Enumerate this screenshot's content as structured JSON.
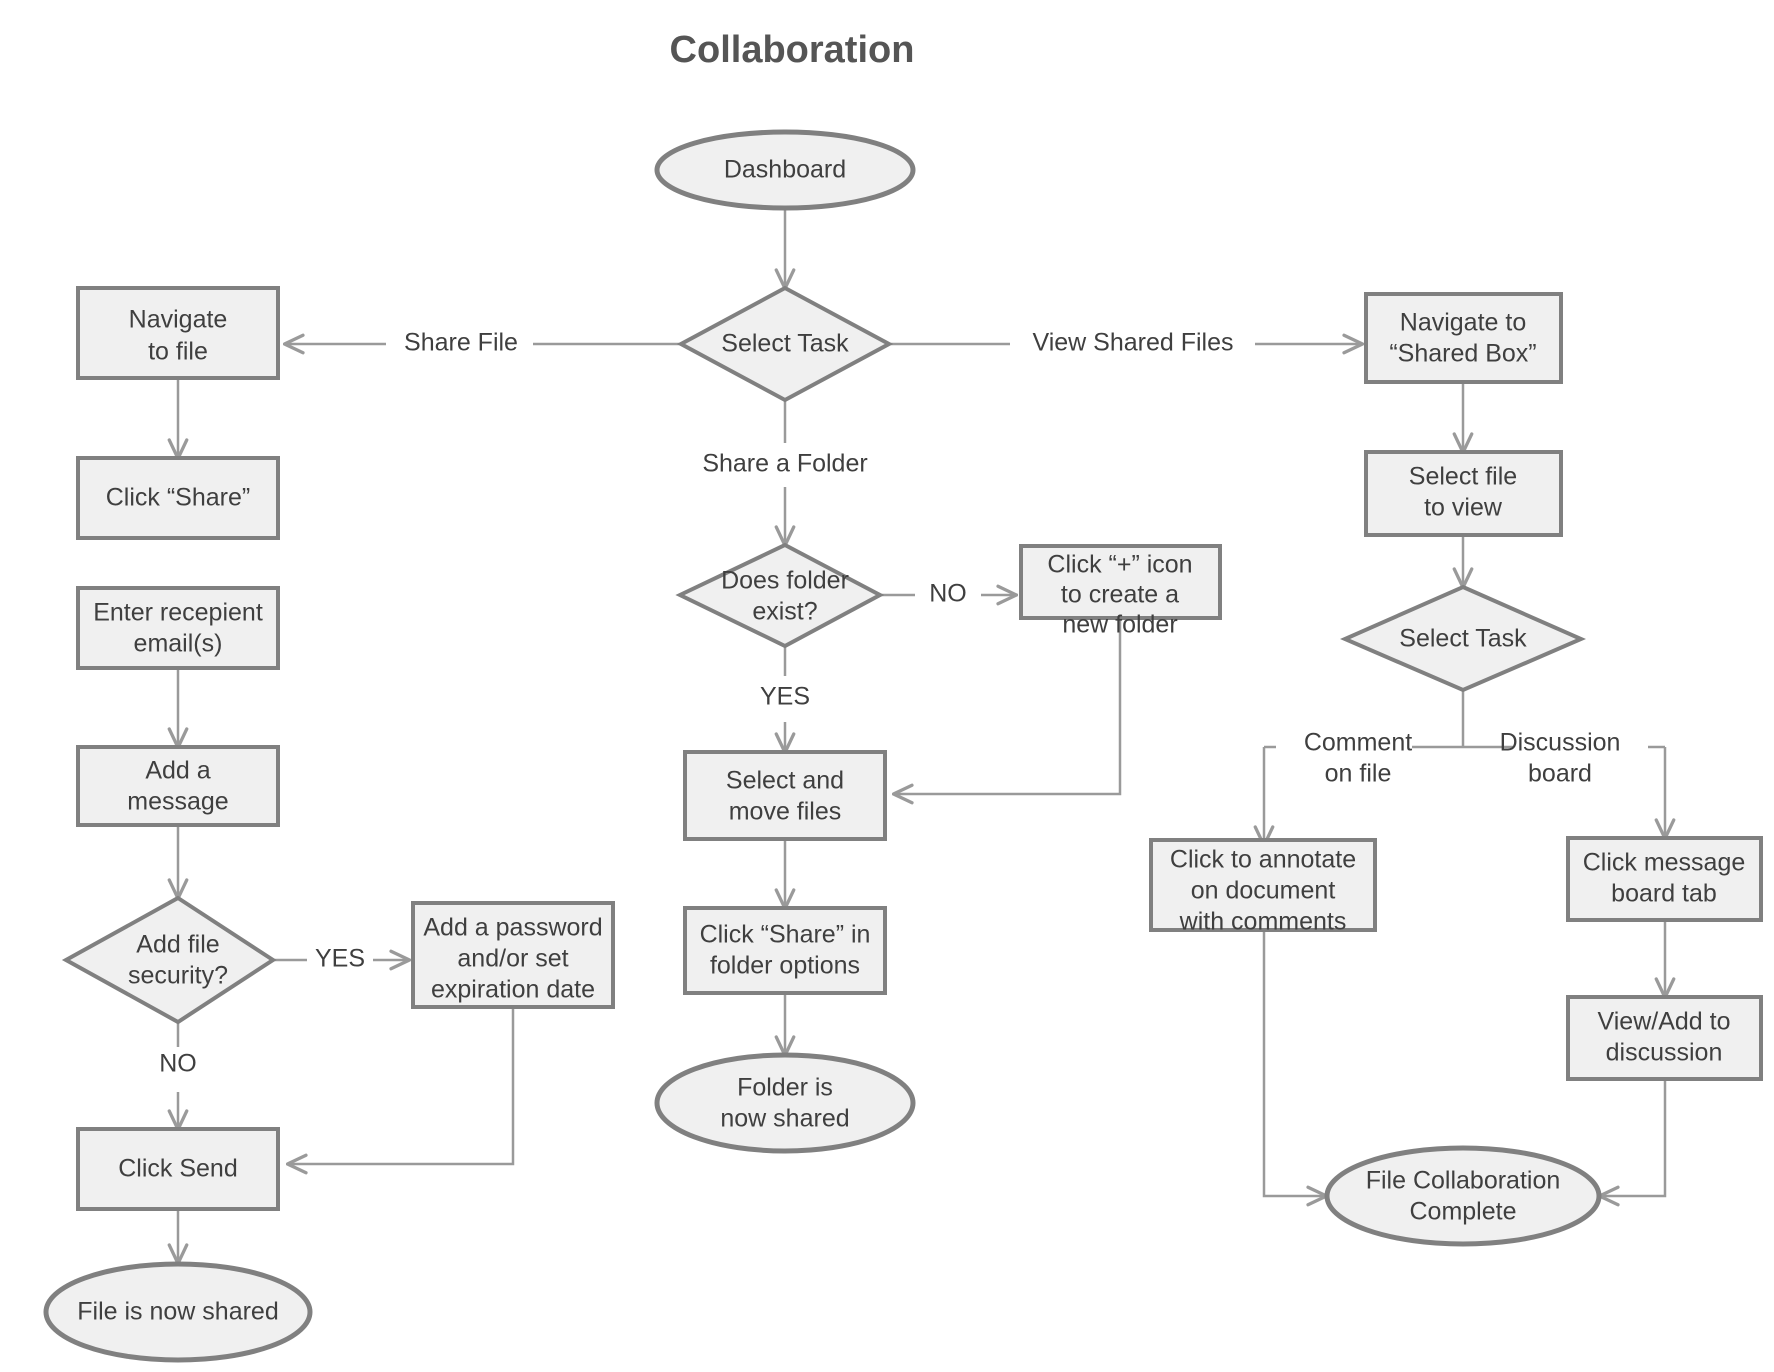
{
  "title": "Collaboration",
  "theme": {
    "node_fill": "#f0f0f0",
    "node_stroke": "#808080",
    "edge_stroke": "#9a9a9a",
    "text_color": "#3f3f3f",
    "title_color": "#555555",
    "background": "#ffffff"
  },
  "chart_data": {
    "type": "diagram",
    "diagram_type": "flowchart",
    "title": "Collaboration",
    "nodes": [
      {
        "id": "dashboard",
        "shape": "ellipse",
        "lines": [
          "Dashboard"
        ]
      },
      {
        "id": "select-task-1",
        "shape": "diamond",
        "lines": [
          "Select Task"
        ]
      },
      {
        "id": "navigate-to-file",
        "shape": "rect",
        "lines": [
          "Navigate",
          "to file"
        ]
      },
      {
        "id": "click-share",
        "shape": "rect",
        "lines": [
          "Click “Share”"
        ]
      },
      {
        "id": "enter-recipient-email",
        "shape": "rect",
        "lines": [
          "Enter recepient",
          "email(s)"
        ]
      },
      {
        "id": "add-a-message",
        "shape": "rect",
        "lines": [
          "Add a",
          "message"
        ]
      },
      {
        "id": "add-file-security",
        "shape": "diamond",
        "lines": [
          "Add file",
          "security?"
        ]
      },
      {
        "id": "add-password",
        "shape": "rect",
        "lines": [
          "Add a password",
          "and/or set",
          "expiration date"
        ]
      },
      {
        "id": "click-send",
        "shape": "rect",
        "lines": [
          "Click Send"
        ]
      },
      {
        "id": "file-is-now-shared",
        "shape": "ellipse",
        "lines": [
          "File is now shared"
        ]
      },
      {
        "id": "does-folder-exist",
        "shape": "diamond",
        "lines": [
          "Does folder",
          "exist?"
        ]
      },
      {
        "id": "click-plus-icon",
        "shape": "rect",
        "lines": [
          "Click “+” icon",
          "to create a",
          "new folder"
        ]
      },
      {
        "id": "select-and-move-files",
        "shape": "rect",
        "lines": [
          "Select and",
          "move files"
        ]
      },
      {
        "id": "click-share-folder-options",
        "shape": "rect",
        "lines": [
          "Click “Share” in",
          "folder options"
        ]
      },
      {
        "id": "folder-is-now-shared",
        "shape": "ellipse",
        "lines": [
          "Folder is",
          "now shared"
        ]
      },
      {
        "id": "navigate-shared-box",
        "shape": "rect",
        "lines": [
          "Navigate to",
          "“Shared Box”"
        ]
      },
      {
        "id": "select-file-to-view",
        "shape": "rect",
        "lines": [
          "Select file",
          "to view"
        ]
      },
      {
        "id": "select-task-2",
        "shape": "diamond",
        "lines": [
          "Select Task"
        ]
      },
      {
        "id": "click-to-annotate",
        "shape": "rect",
        "lines": [
          "Click to annotate",
          "on document",
          "with comments"
        ]
      },
      {
        "id": "click-message-board-tab",
        "shape": "rect",
        "lines": [
          "Click message",
          "board tab"
        ]
      },
      {
        "id": "view-add-discussion",
        "shape": "rect",
        "lines": [
          "View/Add to",
          "discussion"
        ]
      },
      {
        "id": "file-collaboration-complete",
        "shape": "ellipse",
        "lines": [
          "File Collaboration",
          "Complete"
        ]
      }
    ],
    "edges": [
      {
        "from": "dashboard",
        "to": "select-task-1",
        "label": ""
      },
      {
        "from": "select-task-1",
        "to": "navigate-to-file",
        "label": "Share File"
      },
      {
        "from": "select-task-1",
        "to": "navigate-shared-box",
        "label": "View Shared Files"
      },
      {
        "from": "select-task-1",
        "to": "does-folder-exist",
        "label": "Share a Folder"
      },
      {
        "from": "navigate-to-file",
        "to": "click-share",
        "label": ""
      },
      {
        "from": "enter-recipient-email",
        "to": "add-a-message",
        "label": ""
      },
      {
        "from": "add-a-message",
        "to": "add-file-security",
        "label": ""
      },
      {
        "from": "add-file-security",
        "to": "add-password",
        "label": "YES"
      },
      {
        "from": "add-file-security",
        "to": "click-send",
        "label": "NO"
      },
      {
        "from": "add-password",
        "to": "click-send",
        "label": ""
      },
      {
        "from": "click-send",
        "to": "file-is-now-shared",
        "label": ""
      },
      {
        "from": "does-folder-exist",
        "to": "click-plus-icon",
        "label": "NO"
      },
      {
        "from": "does-folder-exist",
        "to": "select-and-move-files",
        "label": "YES"
      },
      {
        "from": "click-plus-icon",
        "to": "select-and-move-files",
        "label": ""
      },
      {
        "from": "select-and-move-files",
        "to": "click-share-folder-options",
        "label": ""
      },
      {
        "from": "click-share-folder-options",
        "to": "folder-is-now-shared",
        "label": ""
      },
      {
        "from": "navigate-shared-box",
        "to": "select-file-to-view",
        "label": ""
      },
      {
        "from": "select-file-to-view",
        "to": "select-task-2",
        "label": ""
      },
      {
        "from": "select-task-2",
        "to": "click-to-annotate",
        "label": "Comment on file"
      },
      {
        "from": "select-task-2",
        "to": "click-message-board-tab",
        "label": "Discussion board"
      },
      {
        "from": "click-message-board-tab",
        "to": "view-add-discussion",
        "label": ""
      },
      {
        "from": "click-to-annotate",
        "to": "file-collaboration-complete",
        "label": ""
      },
      {
        "from": "view-add-discussion",
        "to": "file-collaboration-complete",
        "label": ""
      }
    ]
  },
  "labels": {
    "share_file": "Share File",
    "view_shared_files": "View Shared Files",
    "share_a_folder": "Share a Folder",
    "folder_no": "NO",
    "folder_yes": "YES",
    "security_yes": "YES",
    "security_no": "NO",
    "comment_on_file_l1": "Comment",
    "comment_on_file_l2": "on file",
    "discussion_board_l1": "Discussion",
    "discussion_board_l2": "board"
  },
  "nodes": {
    "dashboard": {
      "l1": "Dashboard"
    },
    "select_task_1": {
      "l1": "Select Task"
    },
    "navigate_to_file": {
      "l1": "Navigate",
      "l2": "to file"
    },
    "click_share": {
      "l1": "Click “Share”"
    },
    "enter_recipient_email": {
      "l1": "Enter recepient",
      "l2": "email(s)"
    },
    "add_a_message": {
      "l1": "Add a",
      "l2": "message"
    },
    "add_file_security": {
      "l1": "Add file",
      "l2": "security?"
    },
    "add_password": {
      "l1": "Add a password",
      "l2": "and/or set",
      "l3": "expiration date"
    },
    "click_send": {
      "l1": "Click Send"
    },
    "file_is_now_shared": {
      "l1": "File is now shared"
    },
    "does_folder_exist": {
      "l1": "Does folder",
      "l2": "exist?"
    },
    "click_plus_icon": {
      "l1": "Click “+” icon",
      "l2": "to create a",
      "l3": "new folder"
    },
    "select_and_move_files": {
      "l1": "Select and",
      "l2": "move files"
    },
    "click_share_folder_options": {
      "l1": "Click “Share” in",
      "l2": "folder options"
    },
    "folder_is_now_shared": {
      "l1": "Folder is",
      "l2": "now shared"
    },
    "navigate_shared_box": {
      "l1": "Navigate to",
      "l2": "“Shared Box”"
    },
    "select_file_to_view": {
      "l1": "Select file",
      "l2": "to view"
    },
    "select_task_2": {
      "l1": "Select Task"
    },
    "click_to_annotate": {
      "l1": "Click to annotate",
      "l2": "on document",
      "l3": "with comments"
    },
    "click_message_board_tab": {
      "l1": "Click message",
      "l2": "board tab"
    },
    "view_add_discussion": {
      "l1": "View/Add to",
      "l2": "discussion"
    },
    "file_collaboration_complete": {
      "l1": "File Collaboration",
      "l2": "Complete"
    }
  }
}
